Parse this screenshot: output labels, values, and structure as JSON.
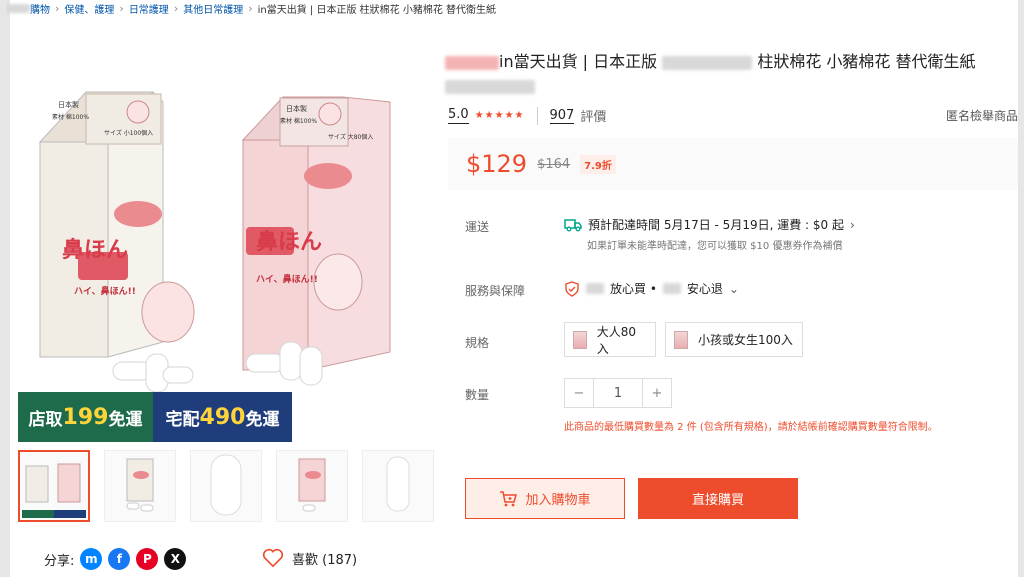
{
  "breadcrumb": {
    "items": [
      "購物",
      "保健、護理",
      "日常護理",
      "其他日常護理"
    ],
    "current": "in當天出貨 | 日本正版 柱狀棉花 小豬棉花 替代衛生紙"
  },
  "product": {
    "title_prefix": "in當天出貨 | 日本正版",
    "title_suffix": "柱狀棉花 小豬棉花 替代衛生紙",
    "rating": "5.0",
    "reviews_count": "907",
    "reviews_label": "評價",
    "report_label": "匿名檢舉商品",
    "price": "$129",
    "original_price": "$164",
    "discount": "7.9折"
  },
  "gallery": {
    "promo_store_label": "店取",
    "promo_store_amount": "199",
    "promo_home_label": "宅配",
    "promo_home_amount": "490",
    "promo_free": "免運",
    "box_left_top": "日本製",
    "box_left_material": "素材 棉100%",
    "box_left_size": "サイズ 小100個入",
    "box_right_top": "日本製",
    "box_right_material": "素材 棉100%",
    "box_right_size": "サイズ 大80個入",
    "box_brand": "鼻ほん",
    "box_speech": "ハイ、鼻ほん!!"
  },
  "shipping": {
    "label": "運送",
    "estimate": "預計配達時間 5月17日 - 5月19日, 運費 : $0 起",
    "note": "如果訂單未能準時配達，您可以獲取 $10 優惠券作為補償"
  },
  "service": {
    "label": "服務與保障",
    "text_a": "放心買 •",
    "text_b": "安心退"
  },
  "variants": {
    "label": "規格",
    "options": [
      "大人80入",
      "小孩或女生100入"
    ]
  },
  "quantity": {
    "label": "數量",
    "value": "1",
    "minus": "−",
    "plus": "+"
  },
  "warning": "此商品的最低購買數量為 2 件 (包含所有規格)，請於結帳前確認購買數量符合限制。",
  "actions": {
    "add_to_cart": "加入購物車",
    "buy_now": "直接購買"
  },
  "social": {
    "share_label": "分享:",
    "like_label": "喜歡 (187)"
  },
  "colors": {
    "brand": "#ee4d2d",
    "promo_green": "#1d6b4a",
    "promo_blue": "#1e3d7a"
  }
}
